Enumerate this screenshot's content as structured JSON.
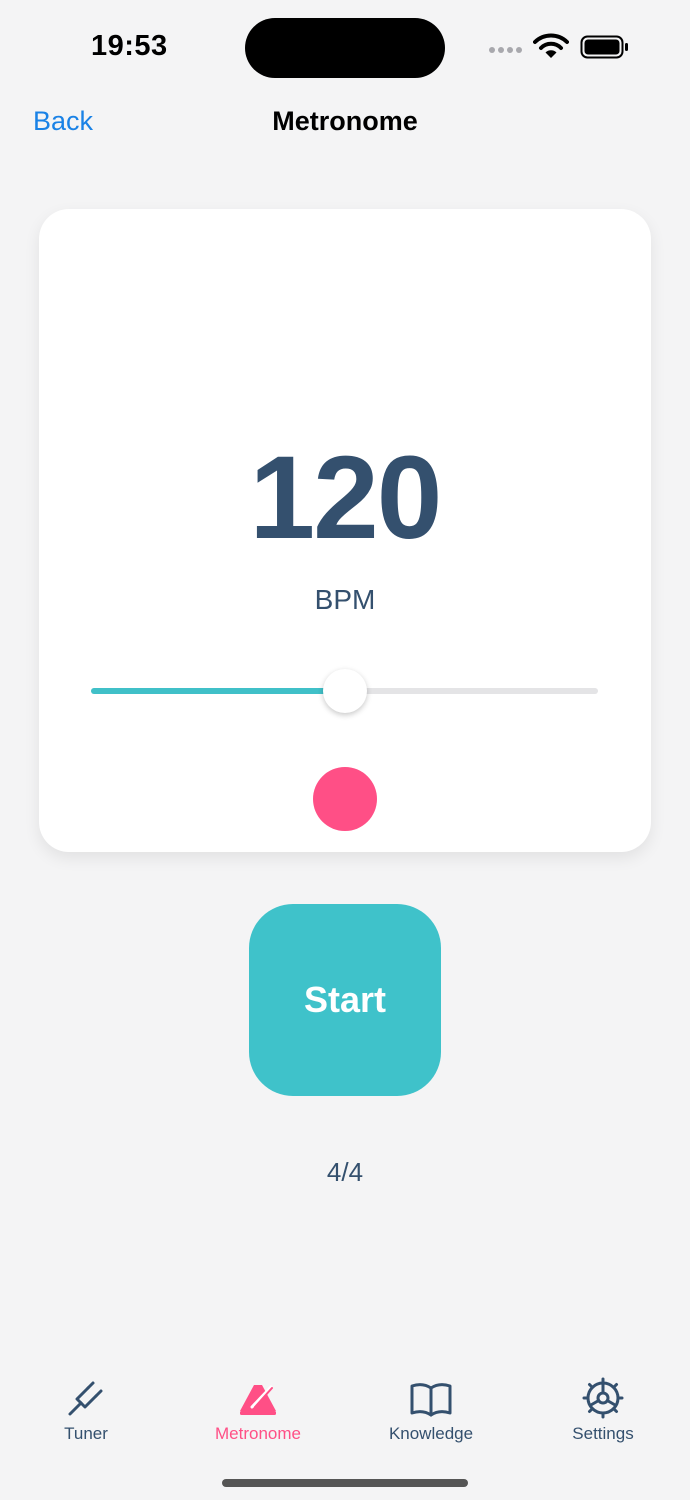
{
  "status": {
    "time": "19:53"
  },
  "nav": {
    "back_label": "Back",
    "title": "Metronome"
  },
  "metronome": {
    "bpm": "120",
    "bpm_unit": "BPM",
    "slider_fraction": 0.5,
    "time_signature": "4/4",
    "start_label": "Start"
  },
  "tabs": [
    {
      "label": "Tuner",
      "icon": "tuning-fork-icon",
      "active": false
    },
    {
      "label": "Metronome",
      "icon": "metronome-icon",
      "active": true
    },
    {
      "label": "Knowledge",
      "icon": "book-icon",
      "active": false
    },
    {
      "label": "Settings",
      "icon": "gear-icon",
      "active": false
    }
  ],
  "colors": {
    "accent": "#3fc2ca",
    "active_tab": "#ff4f86",
    "beat_indicator": "#ff4f86",
    "text": "#34506e",
    "link": "#1a82e6"
  }
}
